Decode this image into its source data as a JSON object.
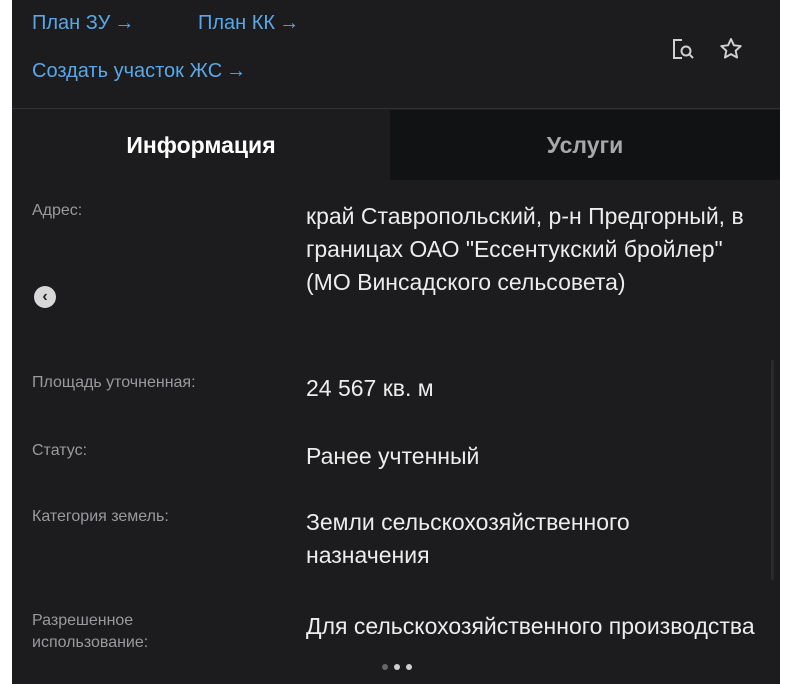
{
  "links": {
    "plan_zu": "План ЗУ",
    "plan_kk": "План КК",
    "create_plot": "Создать участок ЖС",
    "arrow": "→"
  },
  "tabs": [
    {
      "label": "Информация",
      "active": true
    },
    {
      "label": "Услуги",
      "active": false
    }
  ],
  "fields": {
    "address": {
      "label": "Адрес:",
      "value": "край Ставропольский, р-н Предгорный, в границах ОАО \"Ессентукский бройлер\" (МО Винсадского сельсовета)"
    },
    "area": {
      "label": "Площадь уточненная:",
      "value": "24 567 кв. м"
    },
    "status": {
      "label": "Статус:",
      "value": "Ранее учтенный"
    },
    "category": {
      "label": "Категория земель:",
      "value": "Земли сельскохозяйственного назначения"
    },
    "permitted_use": {
      "label": "Разрешенное использование:",
      "value": "Для сельскохозяйственного производства"
    }
  },
  "icons": {
    "search_doc": "search-document-icon",
    "favorite": "star-icon",
    "prev": "chevron-left-icon"
  },
  "colors": {
    "background": "#1c1c1e",
    "link": "#5aa7e8",
    "label": "#9a9a9e",
    "value": "#ececec"
  }
}
